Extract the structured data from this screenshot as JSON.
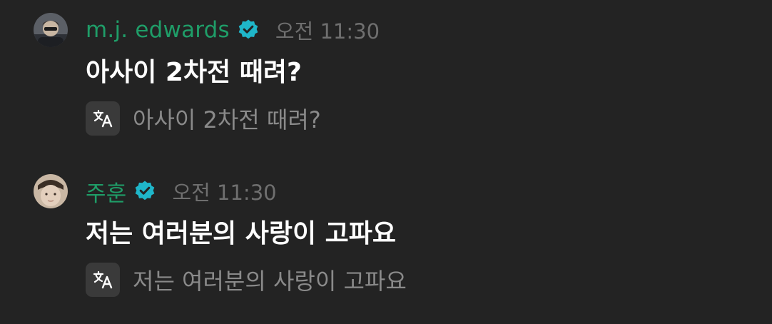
{
  "messages": [
    {
      "username": "m.j. edwards",
      "username_color": "#1f9d68",
      "verified": true,
      "timestamp": "오전 11:30",
      "text": "아사이 2차전 때려?",
      "translation": "아사이 2차전 때려?",
      "avatar_icon": "user-avatar",
      "translate_icon": "translate-icon"
    },
    {
      "username": "주훈",
      "username_color": "#1f9d68",
      "verified": true,
      "timestamp": "오전 11:30",
      "text": "저는 여러분의 사랑이 고파요",
      "translation": "저는 여러분의 사랑이 고파요",
      "avatar_icon": "user-avatar",
      "translate_icon": "translate-icon"
    }
  ],
  "colors": {
    "background": "#232323",
    "badge": "#1fb6c9",
    "timestamp": "#6f6f6f",
    "translation_text": "#8a8a8a",
    "translate_button_bg": "#3a3a3a"
  }
}
